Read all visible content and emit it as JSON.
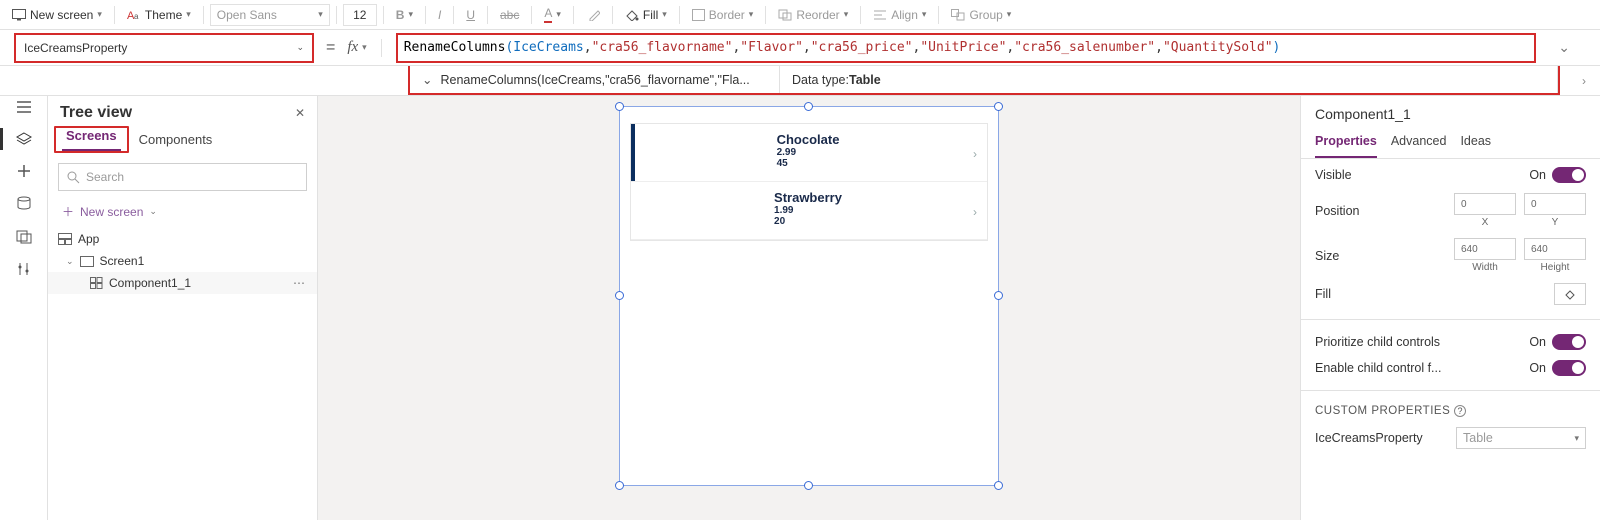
{
  "ribbon": {
    "newScreen": "New screen",
    "theme": "Theme",
    "font": "Open Sans",
    "fontSize": "12",
    "fill": "Fill",
    "border": "Border",
    "reorder": "Reorder",
    "align": "Align",
    "group": "Group"
  },
  "property": {
    "selected": "IceCreamsProperty"
  },
  "formula": {
    "fn": "RenameColumns",
    "ds": "IceCreams",
    "args": [
      "\"cra56_flavorname\"",
      "\"Flavor\"",
      "\"cra56_price\"",
      "\"UnitPrice\"",
      "\"cra56_salenumber\"",
      "\"QuantitySold\""
    ],
    "resultShort": "RenameColumns(IceCreams,\"cra56_flavorname\",\"Fla...",
    "dataTypeLabel": "Data type: ",
    "dataType": "Table"
  },
  "tree": {
    "title": "Tree view",
    "tabScreens": "Screens",
    "tabComponents": "Components",
    "searchPlaceholder": "Search",
    "newScreen": "New screen",
    "app": "App",
    "screen1": "Screen1",
    "component": "Component1_1"
  },
  "gallery": [
    {
      "title": "Chocolate",
      "price": "2.99",
      "qty": "45",
      "selected": true
    },
    {
      "title": "Strawberry",
      "price": "1.99",
      "qty": "20",
      "selected": false
    }
  ],
  "props": {
    "title": "Component1_1",
    "tabProperties": "Properties",
    "tabAdvanced": "Advanced",
    "tabIdeas": "Ideas",
    "visible": "Visible",
    "on": "On",
    "position": "Position",
    "x": "0",
    "xl": "X",
    "y": "0",
    "yl": "Y",
    "size": "Size",
    "w": "640",
    "wl": "Width",
    "h": "640",
    "hl": "Height",
    "fill": "Fill",
    "prio": "Prioritize child controls",
    "enable": "Enable child control f...",
    "custom": "CUSTOM PROPERTIES",
    "cpName": "IceCreamsProperty",
    "cpType": "Table"
  }
}
